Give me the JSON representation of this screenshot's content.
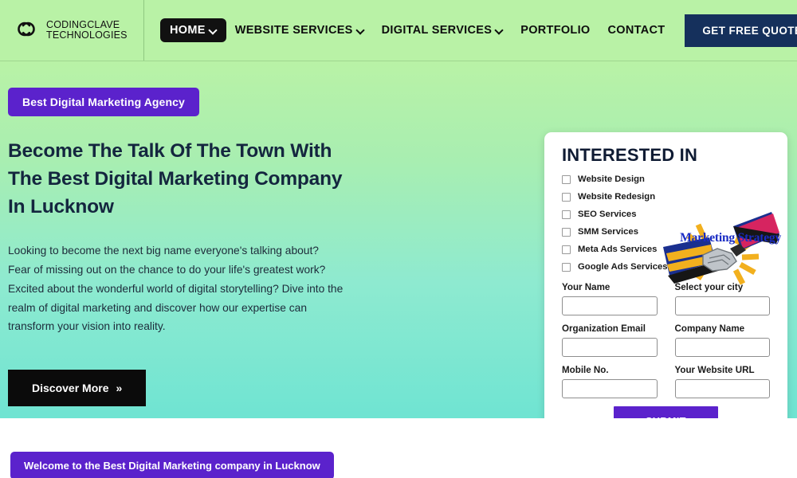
{
  "brand": {
    "logo_icon": "interlocking-rings-logo",
    "name_line1": "CODINGCLAVE",
    "name_line2": "TECHNOLOGIES"
  },
  "nav": {
    "items": [
      {
        "label": "HOME",
        "has_caret": true,
        "active": true
      },
      {
        "label": "WEBSITE SERVICES",
        "has_caret": true,
        "active": false
      },
      {
        "label": "DIGITAL SERVICES",
        "has_caret": true,
        "active": false
      },
      {
        "label": "PORTFOLIO",
        "has_caret": false,
        "active": false
      },
      {
        "label": "CONTACT",
        "has_caret": false,
        "active": false
      }
    ],
    "cta_label": "GET FREE QUOTE",
    "cta_chevron": "»",
    "cta_color": "#15305c"
  },
  "hero": {
    "badge": "Best Digital Marketing Agency",
    "badge_color": "#5b22cc",
    "title": "Become The Talk Of The Town With The Best Digital Marketing Company In Lucknow",
    "paragraph": "Looking to become the next big name everyone's talking about? Fear of missing out on the chance to do your life's greatest work? Excited about the wonderful world of digital storytelling? Dive into the realm of digital marketing and discover how our expertise can transform your vision into reality.",
    "cta_label": "Discover More",
    "cta_chevron": "»",
    "gradient_from": "#b9f2a6",
    "gradient_to": "#6fe4d2"
  },
  "form": {
    "title": "INTERESTED IN",
    "checkboxes": [
      {
        "label": "Website Design",
        "checked": false
      },
      {
        "label": "Website Redesign",
        "checked": false
      },
      {
        "label": "SEO Services",
        "checked": false
      },
      {
        "label": "SMM Services",
        "checked": false
      },
      {
        "label": "Meta Ads Services",
        "checked": false
      },
      {
        "label": "Google Ads Services",
        "checked": false
      }
    ],
    "image_caption": "Marketing Strategy",
    "image_alt": "handshake-between-laptops-illustration",
    "fields": [
      {
        "label": "Your Name",
        "value": "",
        "placeholder": ""
      },
      {
        "label": "Select your city",
        "value": "",
        "placeholder": ""
      },
      {
        "label": "Organization Email",
        "value": "",
        "placeholder": ""
      },
      {
        "label": "Company Name",
        "value": "",
        "placeholder": ""
      },
      {
        "label": "Mobile No.",
        "value": "",
        "placeholder": ""
      },
      {
        "label": "Your Website URL",
        "value": "",
        "placeholder": ""
      }
    ],
    "submit_label": "SUBMIT",
    "submit_color": "#5b22cc"
  },
  "bottom": {
    "welcome_badge": "Welcome to the Best Digital Marketing company in Lucknow",
    "badge_color": "#5b22cc"
  }
}
